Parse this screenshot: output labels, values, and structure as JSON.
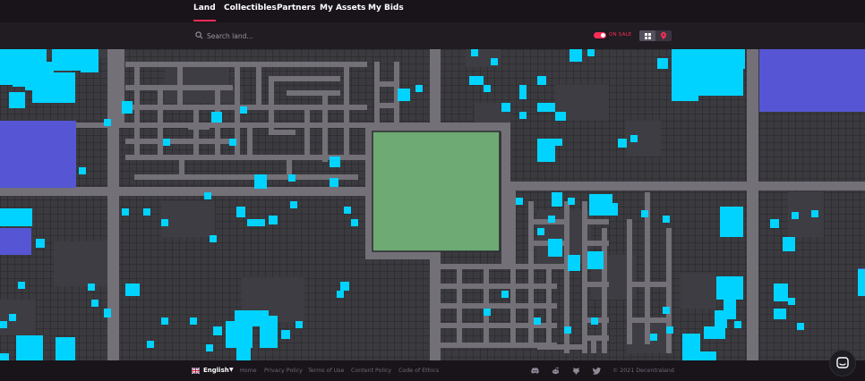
{
  "nav": {
    "tabs": [
      {
        "label": "Land",
        "active": true
      },
      {
        "label": "Collectibles",
        "active": false
      },
      {
        "label": "Partners",
        "active": false
      },
      {
        "label": "My Assets",
        "active": false
      },
      {
        "label": "My Bids",
        "active": false
      }
    ],
    "accent_color": "#ff2d55"
  },
  "search": {
    "placeholder": "Search land...",
    "icon": "search-icon"
  },
  "filters": {
    "on_sale_label": "ON SALE",
    "on_sale_enabled": true,
    "view_options": [
      "grid-view-icon",
      "map-pin-icon"
    ]
  },
  "map": {
    "colors": {
      "parcel": "#3a3a3f",
      "parcel_grid": "#26252a",
      "estate": "#3e3d43",
      "road": "#737078",
      "plaza": "#6eaa74",
      "district": "#5656d4",
      "on_sale": "#00d3ff",
      "background": "#18141a"
    }
  },
  "footer": {
    "language": "English",
    "links": [
      "Home",
      "Privacy Policy",
      "Terms of Use",
      "Content Policy",
      "Code of Ethics"
    ],
    "social_icons": [
      "discord-icon",
      "reddit-icon",
      "github-icon",
      "twitter-icon"
    ],
    "copyright": "© 2021 Decentraland"
  },
  "support_chat_icon": "chat-icon"
}
